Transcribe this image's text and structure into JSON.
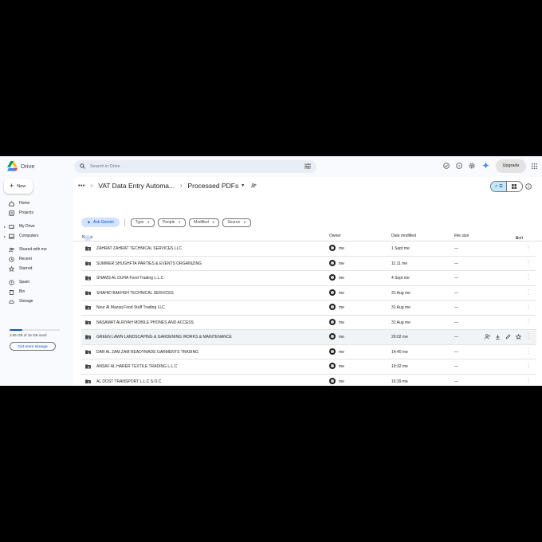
{
  "app": {
    "name": "Drive"
  },
  "search": {
    "placeholder": "Search in Drive"
  },
  "header": {
    "upgrade_label": "Upgrade"
  },
  "sidebar": {
    "new_label": "New",
    "items": [
      {
        "label": "Home",
        "icon": "home-icon"
      },
      {
        "label": "Projects",
        "icon": "projects-icon"
      },
      {
        "label": "My Drive",
        "icon": "my-drive-icon"
      },
      {
        "label": "Computers",
        "icon": "computers-icon"
      },
      {
        "label": "Shared with me",
        "icon": "shared-icon"
      },
      {
        "label": "Recent",
        "icon": "clock-icon"
      },
      {
        "label": "Starred",
        "icon": "star-icon"
      },
      {
        "label": "Spam",
        "icon": "spam-icon"
      },
      {
        "label": "Bin",
        "icon": "bin-icon"
      },
      {
        "label": "Storage",
        "icon": "cloud-icon"
      }
    ],
    "storage_text": "3.85 GB of 15 GB used",
    "storage_fraction": 0.257,
    "get_more_label": "Get more storage"
  },
  "breadcrumb": {
    "folder1": "VAT Data Entry Automa...",
    "current": "Processed PDFs"
  },
  "filters": {
    "ask_gemini": "Ask Gemini",
    "chips": [
      "Type",
      "People",
      "Modified",
      "Source"
    ]
  },
  "columns": {
    "name": "Name",
    "owner": "Owner",
    "date": "Date modified",
    "size": "File size",
    "sort": "Sort"
  },
  "files": [
    {
      "name": "ZAHRAT ZAHRAT TECHNICAL SERVICES LLC",
      "owner": "me",
      "date": "1 Sept me",
      "size": "—"
    },
    {
      "name": "SUMMER SHUGHFTA PARTIES & EVENTS ORGANIZING",
      "owner": "me",
      "date": "11:11 me",
      "size": "—"
    },
    {
      "name": "SHAMS AL DUHA Food Trading L.L.C",
      "owner": "me",
      "date": "4 Sept me",
      "size": "—"
    },
    {
      "name": "SHAHID BAKHSH TECHNICAL SERVICES",
      "owner": "me",
      "date": "31 Aug me",
      "size": "—"
    },
    {
      "name": "Nour Al Mazaq Food Stuff Trading LLC",
      "owner": "me",
      "date": "31 Aug me",
      "size": "—"
    },
    {
      "name": "NASAMAT ALRIYAH MOBILE PHONES AND ACCESS",
      "owner": "me",
      "date": "31 Aug me",
      "size": "—"
    },
    {
      "name": "GREEN LAWN LANDSCAPING & GARDENING WORKS & MAINTENANCE",
      "owner": "me",
      "date": "20:02 me",
      "size": "—"
    },
    {
      "name": "DAR AL ZAM ZAM READYMADE GARMENTS TRADING",
      "owner": "me",
      "date": "14:40 me",
      "size": "—"
    },
    {
      "name": "ANSAF AL HARER TEXTILE TRADING L.L.C",
      "owner": "me",
      "date": "19:32 me",
      "size": "—"
    },
    {
      "name": "AL DOST TRANSPORT L.L.C S.O.C",
      "owner": "me",
      "date": "16:39 me",
      "size": "—"
    }
  ],
  "colors": {
    "accent": "#0b57d0",
    "selected": "#c2e7ff",
    "background": "#f8fafd"
  }
}
